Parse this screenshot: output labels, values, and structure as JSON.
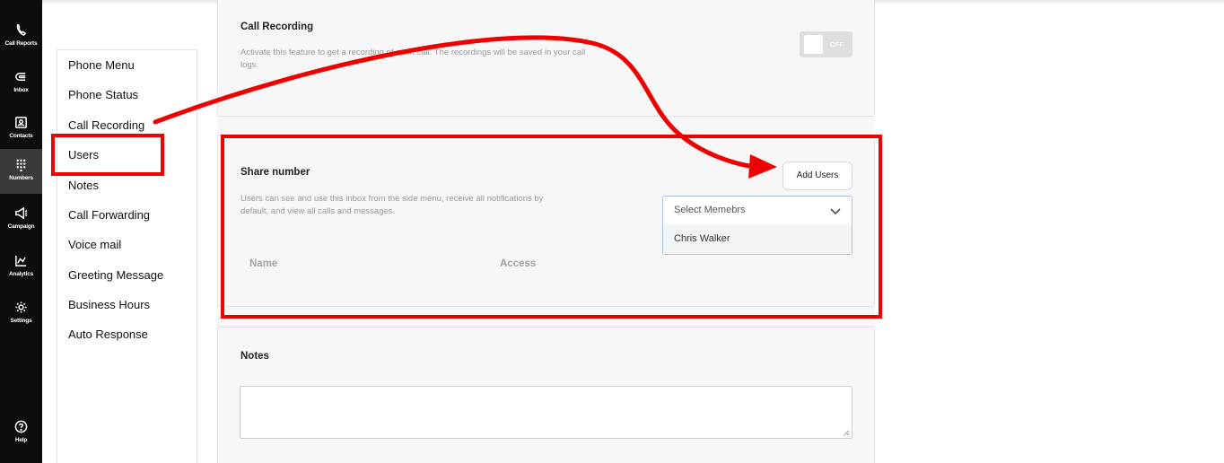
{
  "rail": {
    "items": [
      {
        "label": "Call Reports",
        "icon": "call-reports-icon"
      },
      {
        "label": "Inbox",
        "icon": "inbox-icon"
      },
      {
        "label": "Contacts",
        "icon": "contacts-icon"
      },
      {
        "label": "Numbers",
        "icon": "numbers-icon",
        "active": true
      },
      {
        "label": "Campaign",
        "icon": "campaign-icon"
      },
      {
        "label": "Analytics",
        "icon": "analytics-icon"
      },
      {
        "label": "Settings",
        "icon": "settings-icon"
      },
      {
        "label": "Help",
        "icon": "help-icon"
      }
    ]
  },
  "menu": {
    "items": [
      "Phone Menu",
      "Phone Status",
      "Call Recording",
      "Users",
      "Notes",
      "Call Forwarding",
      "Voice mail",
      "Greeting Message",
      "Business Hours",
      "Auto Response"
    ]
  },
  "call_recording": {
    "title": "Call Recording",
    "desc_line1": "Activate this feature to get a recording of each call. The recordings will be saved in your call",
    "desc_line2": "logs.",
    "toggle_label": "OFF"
  },
  "share": {
    "title": "Share number",
    "desc_line1": "Users can see and use this inbox from the side menu, receive all notifications by",
    "desc_line2": "default, and view all calls and messages.",
    "add_button": "Add Users",
    "select_placeholder": "Select Memebrs",
    "select_option": "Chris Walker",
    "col_name": "Name",
    "col_access": "Access"
  },
  "notes": {
    "title": "Notes",
    "value": ""
  },
  "colors": {
    "annotation": "#ee0000",
    "rail_bg": "#0d0d0d"
  }
}
